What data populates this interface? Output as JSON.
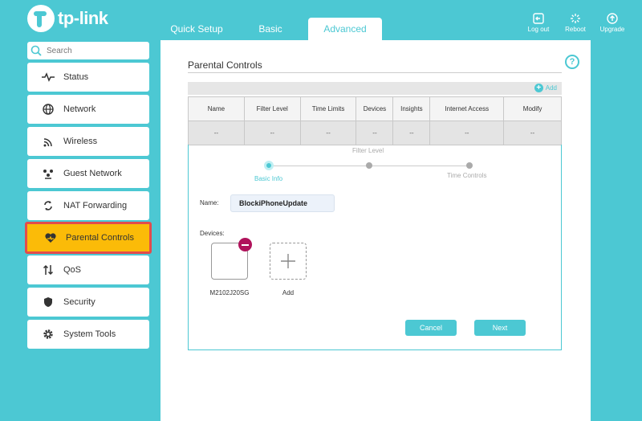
{
  "brand": {
    "logo_text": "tp-link"
  },
  "tabs": [
    {
      "label": "Quick Setup"
    },
    {
      "label": "Basic"
    },
    {
      "label": "Advanced"
    }
  ],
  "top_actions": [
    {
      "label": "Log out",
      "icon": "logout-icon"
    },
    {
      "label": "Reboot",
      "icon": "reboot-icon"
    },
    {
      "label": "Upgrade",
      "icon": "upgrade-icon"
    }
  ],
  "search": {
    "placeholder": "Search"
  },
  "sidebar": {
    "items": [
      {
        "label": "Status",
        "icon": "status-icon"
      },
      {
        "label": "Network",
        "icon": "globe-icon"
      },
      {
        "label": "Wireless",
        "icon": "wifi-icon"
      },
      {
        "label": "Guest Network",
        "icon": "guest-icon"
      },
      {
        "label": "NAT Forwarding",
        "icon": "nat-icon"
      },
      {
        "label": "Parental Controls",
        "icon": "heart-icon",
        "active": true
      },
      {
        "label": "QoS",
        "icon": "qos-icon"
      },
      {
        "label": "Security",
        "icon": "shield-icon"
      },
      {
        "label": "System Tools",
        "icon": "gear-icon"
      }
    ]
  },
  "page": {
    "title": "Parental Controls",
    "help": "?",
    "add_label": "Add",
    "table": {
      "headers": [
        "Name",
        "Filter Level",
        "Time Limits",
        "Devices",
        "Insights",
        "Internet Access",
        "Modify"
      ],
      "row": [
        "--",
        "--",
        "--",
        "--",
        "--",
        "--",
        "--"
      ]
    },
    "steps": {
      "top_label": "Filter Level",
      "first": "Basic Info",
      "last": "Time Controls"
    },
    "form": {
      "name_label": "Name:",
      "name_value": "BlockiPhoneUpdate",
      "devices_label": "Devices:",
      "device_name": "M2102J20SG",
      "add_device_label": "Add"
    },
    "buttons": {
      "cancel": "Cancel",
      "next": "Next"
    }
  },
  "colors": {
    "accent": "#4cc8d3",
    "highlight": "#fbbb08",
    "highlight_border": "#e24c4c",
    "remove": "#b0125b"
  }
}
